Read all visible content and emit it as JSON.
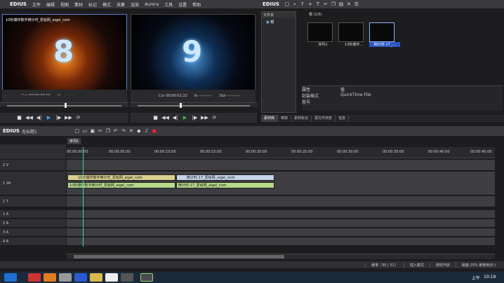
{
  "menu": {
    "app": "EDIUS",
    "items": [
      "文件",
      "编辑",
      "视图",
      "素材",
      "标记",
      "模式",
      "采集",
      "渲染",
      "Aurora",
      "工具",
      "设置",
      "帮助"
    ]
  },
  "player": {
    "overlay_text": "10秒爆炸数字倒计时_爱给网_aigei_com",
    "big_digit": "8",
    "cur_label": "Cur",
    "cur_time": "00:00:03:04",
    "in_label": "In",
    "in_time": "--:--:--:--",
    "out_label": "Out",
    "out_time": "--:--:--:--"
  },
  "recorder": {
    "big_digit": "9",
    "cur_label": "Cur",
    "cur_time": "00:00:01:22",
    "in_label": "In",
    "in_time": "--:--:--:--",
    "out_label": "Out",
    "out_time": "--:--:--:--"
  },
  "bin": {
    "app": "EDIUS",
    "folder_header": "文件夹",
    "folder_root": "根",
    "path_label": "根 (1/3)",
    "items": [
      {
        "caption": "序列1"
      },
      {
        "caption": "10秒爆炸..."
      },
      {
        "caption": "倒计时-17_..."
      }
    ],
    "props": {
      "col1": "属性",
      "col2": "值",
      "row1_k": "封装格式",
      "row1_v": "QuickTime File",
      "row2_k": "卷号",
      "row2_v": ""
    },
    "tabs": [
      "素材库",
      "特效",
      "素材标记",
      "源文件浏览",
      "信息"
    ]
  },
  "timeline": {
    "app": "EDIUS",
    "project": "无标题1",
    "sequence_tab": "序列1",
    "timecodes": [
      "00:00:00:00",
      "00:00:05:00",
      "00:00:10:00",
      "00:00:15:00",
      "00:00:20:00",
      "00:00:25:00",
      "00:00:30:00",
      "00:00:35:00",
      "00:00:40:00",
      "00:00:45:00"
    ],
    "tracks": [
      {
        "name": "2 V"
      },
      {
        "name": "1 VA"
      },
      {
        "name": "1 T"
      },
      {
        "name": "1 A"
      },
      {
        "name": "2 A"
      },
      {
        "name": "3 A"
      },
      {
        "name": "4 A"
      }
    ],
    "clips": {
      "v1": "10秒爆炸数字倒计时_爱给网_aigei_com",
      "v2": "倒计时-17_爱给网_aigei_com",
      "a1": "10秒爆炸数字倒计时_爱给网_aigei_com",
      "a2": "倒计时-17_爱给网_aigei_com"
    }
  },
  "status": {
    "rate": "缓率（30 / 31）",
    "mode": "插入模式",
    "ripple": "波纹开启",
    "disk": "磁盘:25% 被使用(E:)"
  },
  "taskbar": {
    "time": "10:19",
    "ampm": "上午"
  }
}
